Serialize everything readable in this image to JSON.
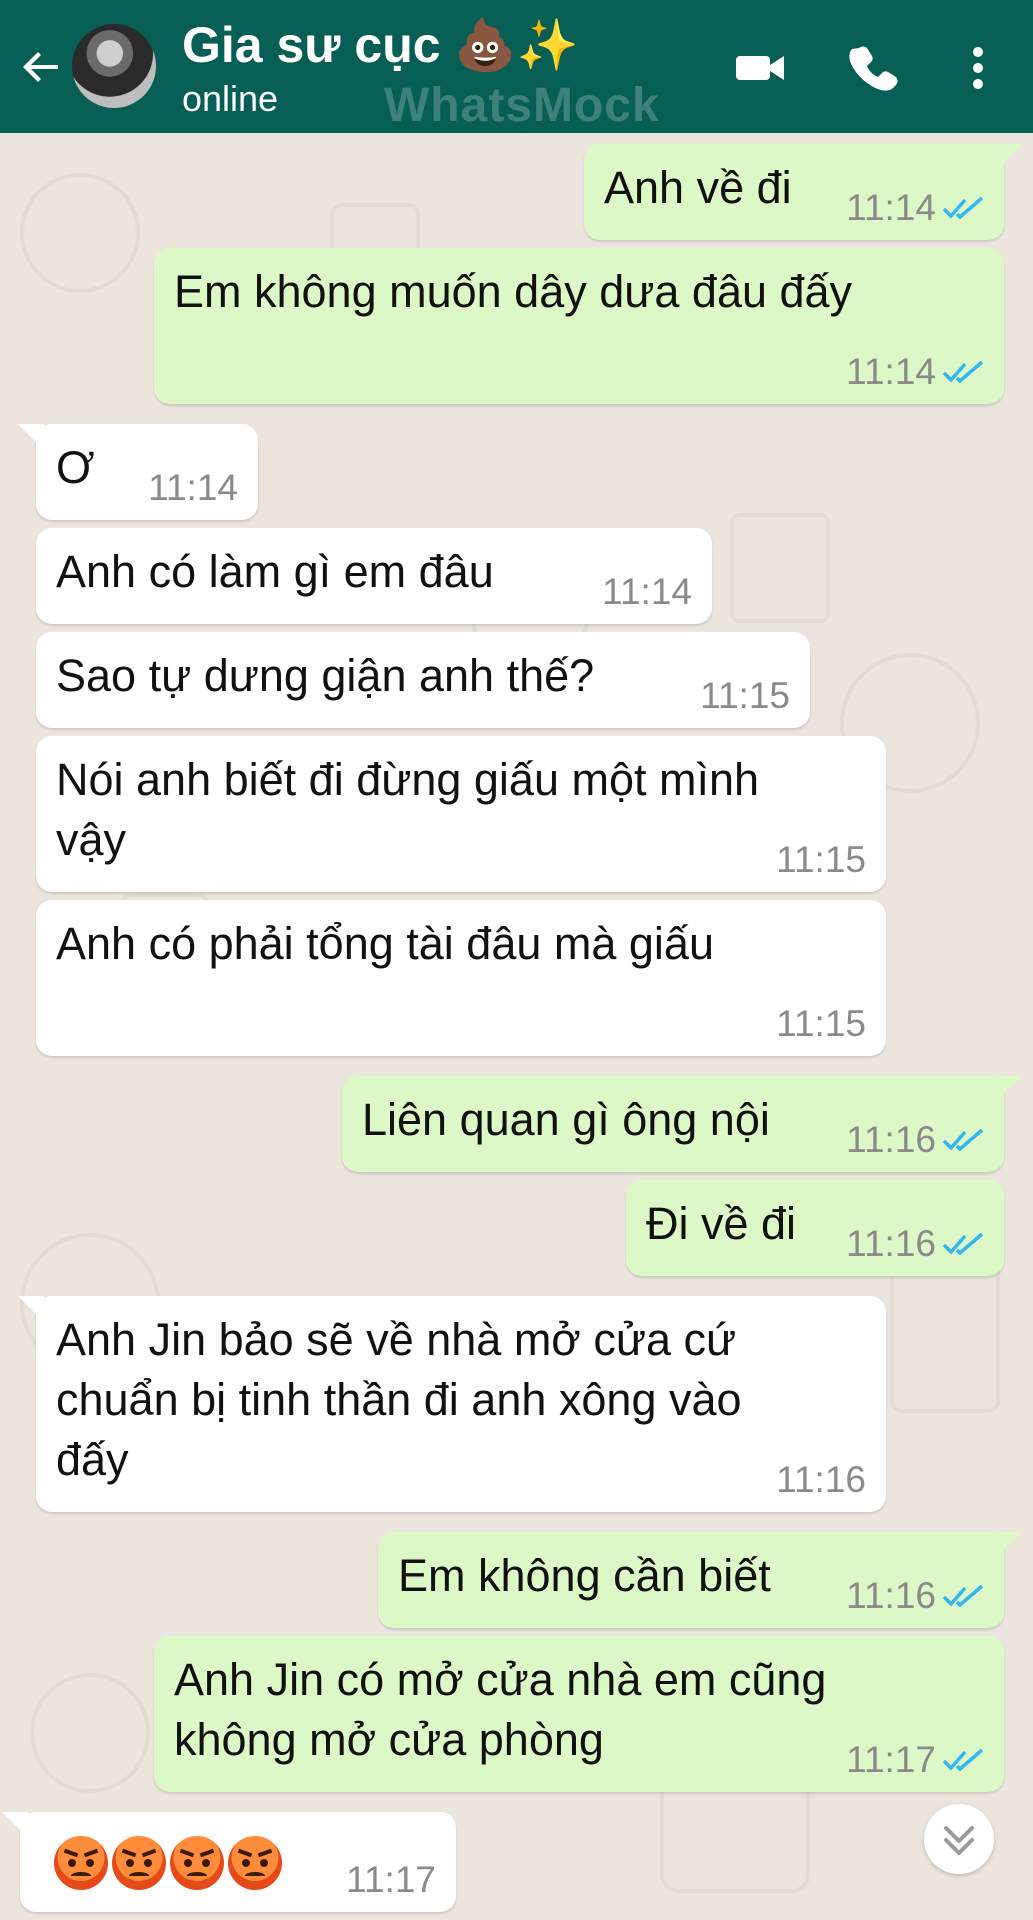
{
  "header": {
    "contact_name": "Gia sư cục 💩✨",
    "status": "online",
    "watermark": "WhatsMock",
    "icons": [
      "back-arrow-icon",
      "avatar",
      "video-call-icon",
      "phone-icon",
      "more-vert-icon"
    ]
  },
  "messages": [
    {
      "dir": "out",
      "text": "Anh về đi",
      "time": "11:14",
      "read": true
    },
    {
      "dir": "out",
      "text": "Em không muốn dây dưa đâu đấy",
      "time": "11:14",
      "read": true
    },
    {
      "dir": "in",
      "text": "Ơ",
      "time": "11:14"
    },
    {
      "dir": "in",
      "text": "Anh có làm gì em đâu",
      "time": "11:14"
    },
    {
      "dir": "in",
      "text": "Sao tự dưng giận anh thế?",
      "time": "11:15"
    },
    {
      "dir": "in",
      "text": "Nói anh biết đi đừng giấu một mình\nvậy",
      "time": "11:15"
    },
    {
      "dir": "in",
      "text": "Anh có phải tổng tài đâu mà giấu",
      "time": "11:15"
    },
    {
      "dir": "out",
      "text": "Liên quan gì ông nội",
      "time": "11:16",
      "read": true
    },
    {
      "dir": "out",
      "text": "Đi về đi",
      "time": "11:16",
      "read": true
    },
    {
      "dir": "in",
      "text": "Anh Jin bảo sẽ về nhà mở cửa cứ\nchuẩn bị tinh thần đi anh xông vào\nđấy",
      "time": "11:16"
    },
    {
      "dir": "out",
      "text": "Em không cần biết",
      "time": "11:16",
      "read": true
    },
    {
      "dir": "out",
      "text": "Anh Jin có mở cửa nhà em cũng\nkhông mở cửa phòng",
      "time": "11:17",
      "read": true
    },
    {
      "dir": "in",
      "text": "😡😡😡😡",
      "time": "11:17",
      "emoji_only": true
    }
  ],
  "colors": {
    "header": "#075e54",
    "outgoing_bubble": "#dcf8c6",
    "incoming_bubble": "#ffffff",
    "background": "#ece5dd",
    "read_ticks": "#34b7f1"
  },
  "scroll_down_icon": "chevron-double-down-icon"
}
